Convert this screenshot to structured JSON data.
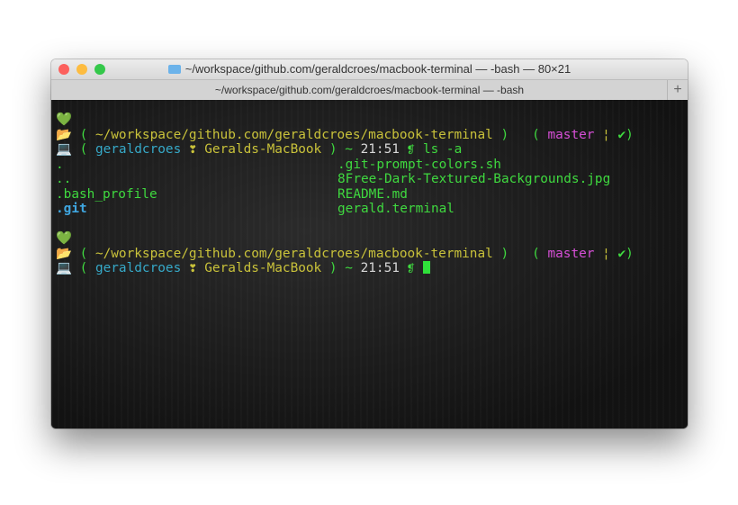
{
  "window": {
    "title": "~/workspace/github.com/geraldcroes/macbook-terminal — -bash — 80×21",
    "tab": "~/workspace/github.com/geraldcroes/macbook-terminal — -bash",
    "new_tab": "+"
  },
  "prompt": {
    "heart": "💚",
    "folder": "📂",
    "laptop": "💻",
    "open": "(",
    "close": ")",
    "path": "~/workspace/github.com/geraldcroes/macbook-terminal",
    "branch_open": "(",
    "branch": "master",
    "sep": "¦",
    "check": "✔",
    "branch_close": ")",
    "user": "geraldcroes",
    "at": "❣",
    "host": "Geralds-MacBook",
    "tilde": "~",
    "time": "21:51",
    "symbol": "❡"
  },
  "command": "ls -a",
  "listing": {
    "col1": [
      ".",
      "..",
      ".bash_profile",
      ".git"
    ],
    "col2": [
      ".git-prompt-colors.sh",
      "8Free-Dark-Textured-Backgrounds.jpg",
      "README.md",
      "gerald.terminal"
    ]
  }
}
